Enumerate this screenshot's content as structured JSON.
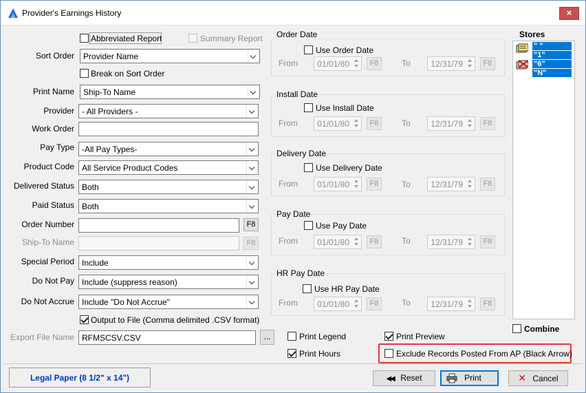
{
  "window": {
    "title": "Provider's Earnings History",
    "close_glyph": "×"
  },
  "options": {
    "abbreviated_report": "Abbreviated Report",
    "summary_report": "Summary Report",
    "break_on_sort_order": "Break on Sort Order",
    "output_to_file": "Output to File (Comma delimited .CSV format)"
  },
  "fields": {
    "sort_order": {
      "label": "Sort Order",
      "value": "Provider Name"
    },
    "print_name": {
      "label": "Print Name",
      "value": "Ship-To Name"
    },
    "provider": {
      "label": "Provider",
      "value": "- All Providers -"
    },
    "work_order": {
      "label": "Work Order",
      "value": ""
    },
    "pay_type": {
      "label": "Pay Type",
      "value": "-All Pay Types-"
    },
    "product_code": {
      "label": "Product Code",
      "value": "All Service Product Codes"
    },
    "delivered_status": {
      "label": "Delivered Status",
      "value": "Both"
    },
    "paid_status": {
      "label": "Paid Status",
      "value": "Both"
    },
    "order_number": {
      "label": "Order Number",
      "value": ""
    },
    "ship_to_name": {
      "label": "Ship-To Name",
      "value": ""
    },
    "special_period": {
      "label": "Special Period",
      "value": "Include"
    },
    "do_not_pay": {
      "label": "Do Not Pay",
      "value": "Include (suppress reason)"
    },
    "do_not_accrue": {
      "label": "Do Not Accrue",
      "value": "Include \"Do Not Accrue\""
    },
    "export_file_name": {
      "label": "Export File Name",
      "value": "RFMSCSV.CSV"
    },
    "f8_label": "F8",
    "browse_label": "..."
  },
  "date_groups": [
    {
      "title": "Order Date",
      "checkbox": "Use Order Date",
      "from": "01/01/80",
      "to": "12/31/79"
    },
    {
      "title": "Install Date",
      "checkbox": "Use Install Date",
      "from": "01/01/80",
      "to": "12/31/79"
    },
    {
      "title": "Delivery Date",
      "checkbox": "Use Delivery Date",
      "from": "01/01/80",
      "to": "12/31/79"
    },
    {
      "title": "Pay Date",
      "checkbox": "Use Pay Date",
      "from": "01/01/80",
      "to": "12/31/79"
    },
    {
      "title": "HR Pay Date",
      "checkbox": "Use HR Pay Date",
      "from": "01/01/80",
      "to": "12/31/79"
    }
  ],
  "date_labels": {
    "from": "From",
    "to": "To",
    "f8": "F8"
  },
  "stores": {
    "title": "Stores",
    "items": [
      "\" \"",
      "\"1\"",
      "\"6\"",
      "\"N\""
    ],
    "combine": "Combine"
  },
  "print_options": {
    "print_legend": "Print Legend",
    "print_preview": "Print Preview",
    "print_hours": "Print Hours",
    "exclude_ap": "Exclude Records Posted From AP (Black Arrow)"
  },
  "status": {
    "paper": "Legal Paper (8 1/2\" x 14\")"
  },
  "buttons": {
    "reset": "Reset",
    "print": "Print",
    "cancel": "Cancel"
  },
  "colors": {
    "accent": "#0078d7",
    "highlight": "#e53935",
    "paper_text": "#0033cc"
  }
}
